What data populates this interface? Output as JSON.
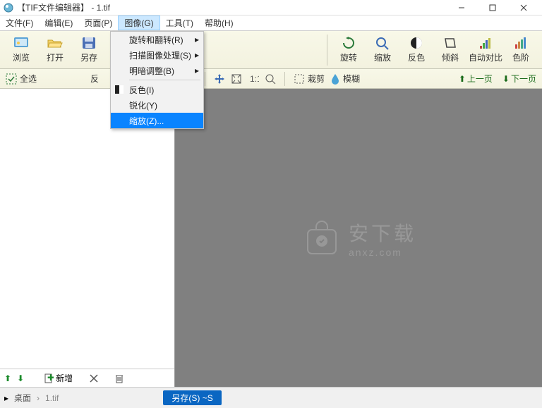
{
  "window": {
    "title": "【TIF文件编辑器】 - 1.tif"
  },
  "menubar": {
    "items": [
      {
        "label": "文件(F)"
      },
      {
        "label": "编辑(E)"
      },
      {
        "label": "页面(P)"
      },
      {
        "label": "图像(G)"
      },
      {
        "label": "工具(T)"
      },
      {
        "label": "帮助(H)"
      }
    ]
  },
  "dropdown": {
    "items": [
      {
        "label": "旋转和翻转(R)",
        "submenu": true
      },
      {
        "label": "扫描图像处理(S)",
        "submenu": true
      },
      {
        "label": "明暗调整(B)",
        "submenu": true
      }
    ],
    "items2": [
      {
        "label": "反色(I)"
      },
      {
        "label": "锐化(Y)"
      },
      {
        "label": "缩放(Z)...",
        "highlight": true
      }
    ]
  },
  "toolbar": {
    "preview": "浏览",
    "open": "打开",
    "saveas": "另存",
    "rotate": "旋转",
    "zoom": "缩放",
    "invert": "反色",
    "skew": "倾斜",
    "autocontrast": "自动对比",
    "levels": "色阶"
  },
  "subtoolbar": {
    "selectall": "全选",
    "invertsel": "反",
    "crop": "栽剪",
    "blur": "模糊",
    "prev": "上一页",
    "next": "下一页"
  },
  "leftpanel": {
    "add": "新增"
  },
  "watermark": {
    "big": "安下载",
    "small": "anxz.com"
  },
  "status": {
    "crumb": "桌面",
    "btn": "另存(S)  ~S"
  }
}
